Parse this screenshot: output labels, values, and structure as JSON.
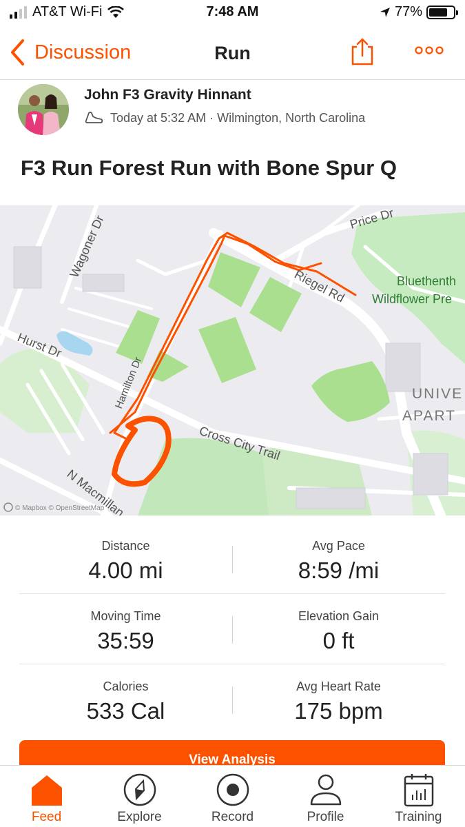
{
  "status_bar": {
    "carrier": "AT&T Wi-Fi",
    "time": "7:48 AM",
    "battery_percent": "77%",
    "battery_level": 0.77
  },
  "nav": {
    "back_label": "Discussion",
    "title": "Run",
    "share_icon": "share-icon",
    "more_icon": "more-icon"
  },
  "activity": {
    "athlete_name": "John F3 Gravity Hinnant",
    "meta": "Today at 5:32 AM · Wilmington, North Carolina",
    "title": "F3 Run Forest Run with Bone Spur Q"
  },
  "map": {
    "labels": {
      "wagoner": "Wagoner Dr",
      "price": "Price Dr",
      "riegel": "Riegel Rd",
      "hurst": "Hurst Dr",
      "hamilton": "Hamilton Dr",
      "cross_city": "Cross City Trail",
      "macmillan": "N Macmillan",
      "bluethenthal_1": "Bluethenth",
      "bluethenthal_2": "Wildflower Pre",
      "univ_1": "UNIVE",
      "univ_2": "APART",
      "attribution": "© Mapbox © OpenStreetMap"
    },
    "route_color": "#fc5200",
    "park_color": "#a9df8f"
  },
  "stats": [
    {
      "label": "Distance",
      "value": "4.00 mi"
    },
    {
      "label": "Avg Pace",
      "value": "8:59 /mi"
    },
    {
      "label": "Moving Time",
      "value": "35:59"
    },
    {
      "label": "Elevation Gain",
      "value": "0 ft"
    },
    {
      "label": "Calories",
      "value": "533 Cal"
    },
    {
      "label": "Avg Heart Rate",
      "value": "175 bpm"
    }
  ],
  "view_analysis_label": "View Analysis",
  "tabs": [
    {
      "label": "Feed",
      "icon": "home-icon",
      "active": true
    },
    {
      "label": "Explore",
      "icon": "compass-icon",
      "active": false
    },
    {
      "label": "Record",
      "icon": "record-icon",
      "active": false
    },
    {
      "label": "Profile",
      "icon": "profile-icon",
      "active": false
    },
    {
      "label": "Training",
      "icon": "calendar-chart-icon",
      "active": false
    }
  ],
  "colors": {
    "accent": "#fc5200"
  }
}
